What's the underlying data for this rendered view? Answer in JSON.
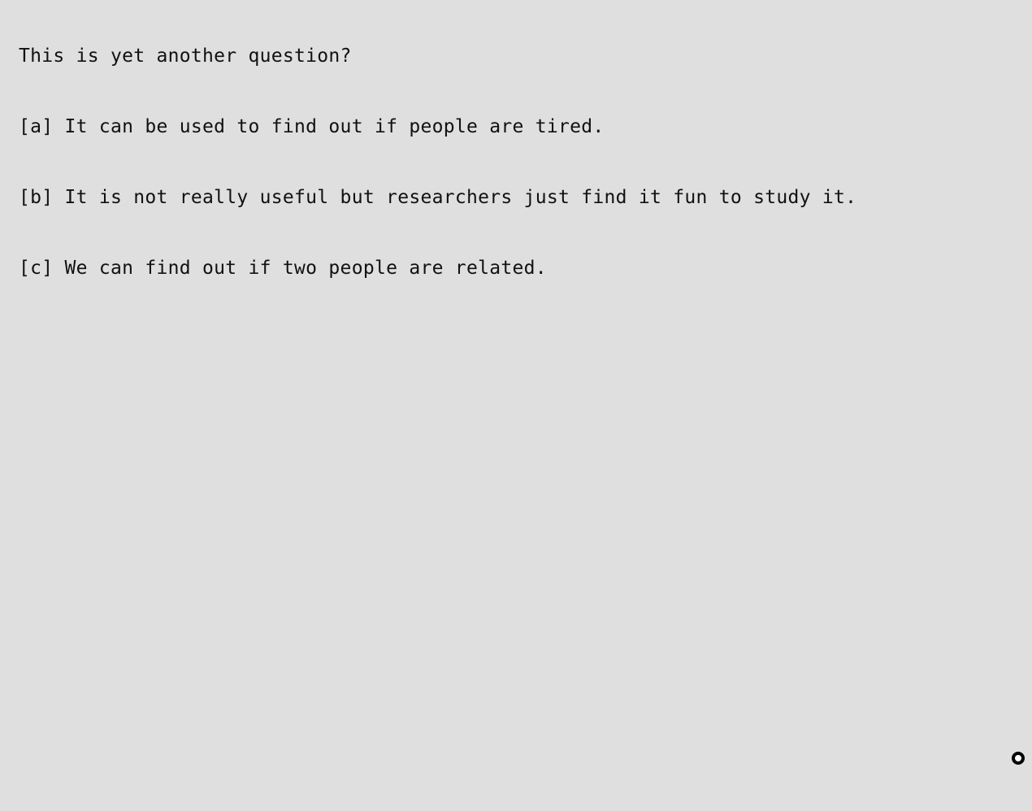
{
  "question": {
    "text": "This is yet another question?"
  },
  "options": [
    {
      "key": "a",
      "label": "[a] It can be used to find out if people are tired."
    },
    {
      "key": "b",
      "label": "[b] It is not really useful but researchers just find it fun to study it."
    },
    {
      "key": "c",
      "label": "[c] We can find out if two people are related."
    }
  ],
  "indicator": {
    "icon": "ring-target-icon"
  },
  "colors": {
    "background": "#dfdfdf",
    "text": "#111111",
    "indicator": "#000000"
  }
}
